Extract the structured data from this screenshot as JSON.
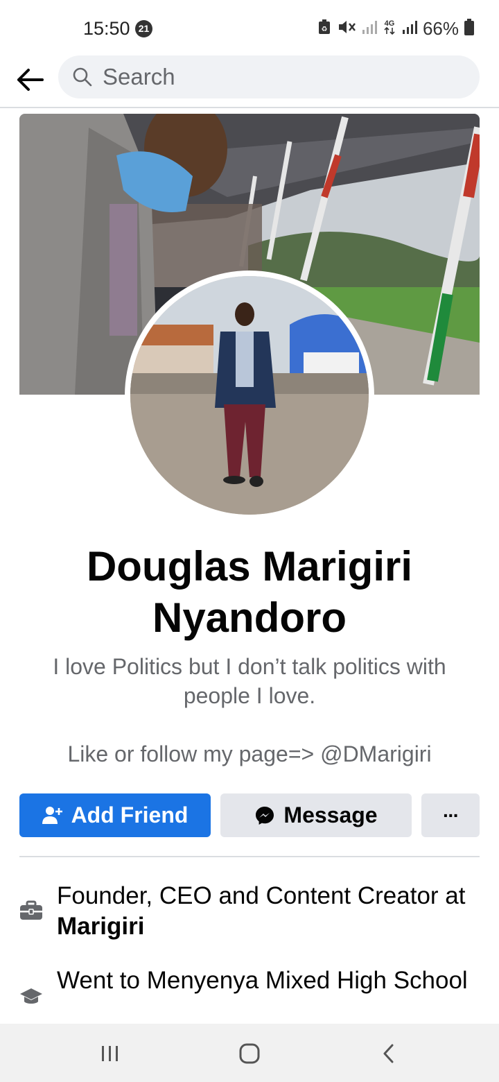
{
  "status_bar": {
    "time": "15:50",
    "notification_count": "21",
    "battery": "66%"
  },
  "top_bar": {
    "search_placeholder": "Search"
  },
  "profile": {
    "name": "Douglas Marigiri Nyandoro",
    "bio": "I love Politics but I don’t talk politics with people I love.",
    "link_text": "Like or follow my page=> @DMarigiri"
  },
  "actions": {
    "add_friend": "Add Friend",
    "message": "Message",
    "more": "···"
  },
  "intro": {
    "work_prefix": "Founder, CEO and Content Creator at ",
    "work_company": "Marigiri",
    "education": "Went to Menyenya Mixed High School"
  },
  "colors": {
    "primary_blue": "#1b74e4",
    "secondary_button": "#e4e6eb",
    "muted_text": "#65676b"
  }
}
